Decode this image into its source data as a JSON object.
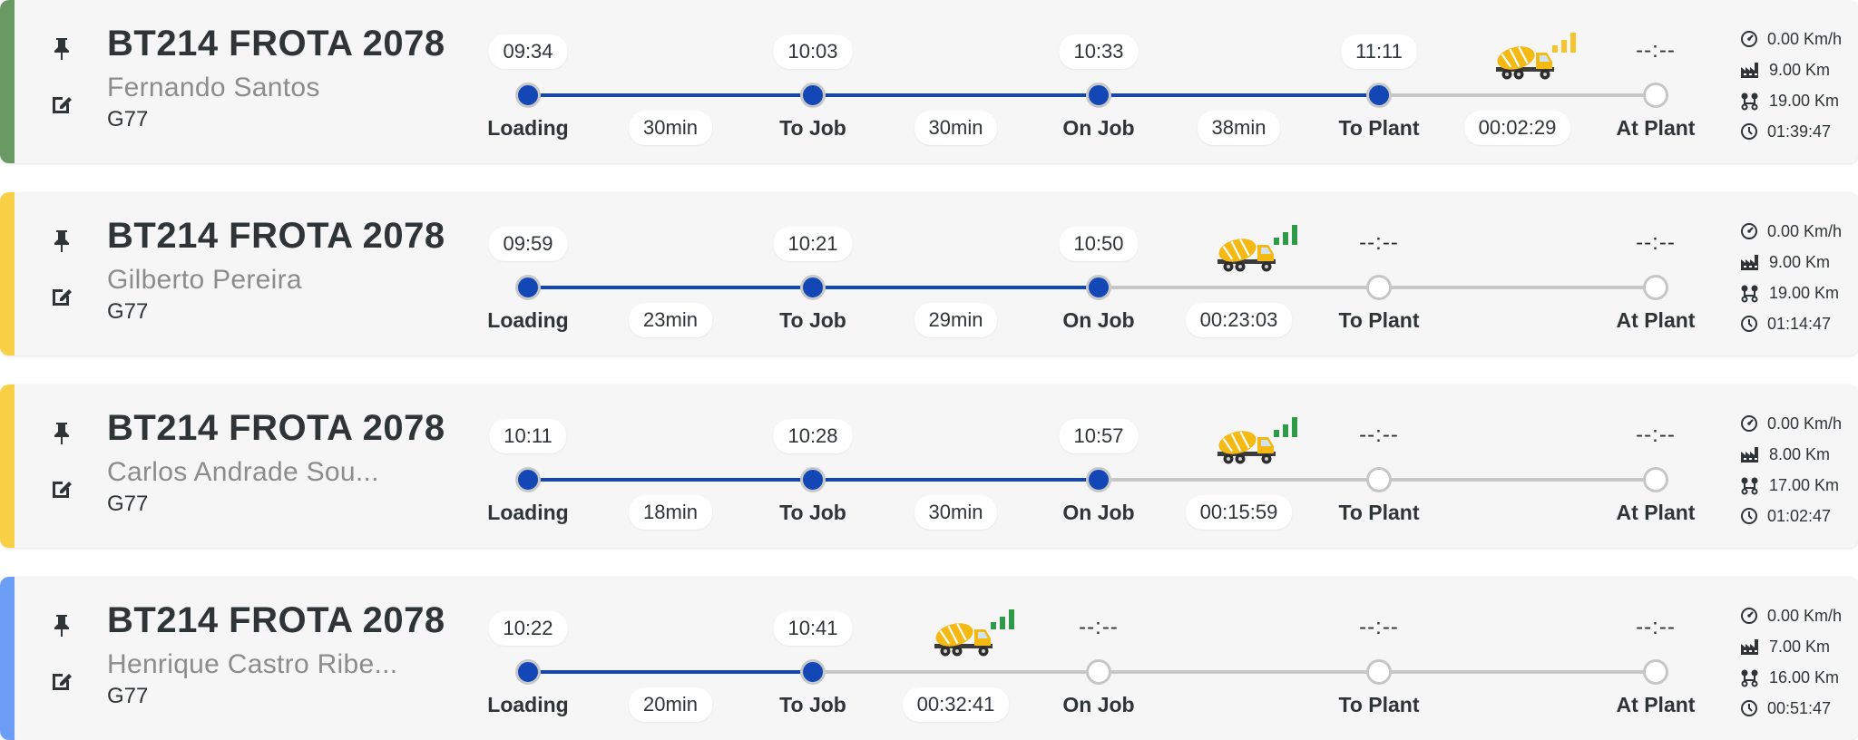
{
  "stripe_colors": [
    "#6a9a64",
    "#f7d046",
    "#f7d046",
    "#6d9ef5"
  ],
  "accent_color": "#1347b5",
  "icons": {
    "pin": "pin-icon",
    "edit": "edit-icon",
    "truck": "concrete-mixer-truck-icon",
    "signal": "signal-strength-icon",
    "speed": "speedometer-icon",
    "plant_distance": "factory-icon",
    "route_distance": "route-icon",
    "elapsed": "clock-icon"
  },
  "stage_labels": [
    "Loading",
    "To Job",
    "On Job",
    "To Plant",
    "At Plant"
  ],
  "trips": [
    {
      "title": "BT214 FROTA 2078",
      "driver": "Fernando Santos",
      "plant": "G77",
      "times": [
        "09:34",
        "10:03",
        "10:33",
        "11:11",
        "--:--"
      ],
      "durations": [
        "30min",
        "30min",
        "38min",
        "00:02:29"
      ],
      "signal_color": "#f4c431",
      "stats": {
        "speed": "0.00 Km/h",
        "plant_distance": "9.00 Km",
        "route_distance": "19.00 Km",
        "elapsed": "01:39:47"
      }
    },
    {
      "title": "BT214 FROTA 2078",
      "driver": "Gilberto Pereira",
      "plant": "G77",
      "times": [
        "09:59",
        "10:21",
        "10:50",
        "--:--",
        "--:--"
      ],
      "durations": [
        "23min",
        "29min",
        "00:23:03"
      ],
      "signal_color": "#2e9a48",
      "stats": {
        "speed": "0.00 Km/h",
        "plant_distance": "9.00 Km",
        "route_distance": "19.00 Km",
        "elapsed": "01:14:47"
      }
    },
    {
      "title": "BT214 FROTA 2078",
      "driver": "Carlos Andrade Sou...",
      "plant": "G77",
      "times": [
        "10:11",
        "10:28",
        "10:57",
        "--:--",
        "--:--"
      ],
      "durations": [
        "18min",
        "30min",
        "00:15:59"
      ],
      "signal_color": "#2e9a48",
      "stats": {
        "speed": "0.00 Km/h",
        "plant_distance": "8.00 Km",
        "route_distance": "17.00 Km",
        "elapsed": "01:02:47"
      }
    },
    {
      "title": "BT214 FROTA 2078",
      "driver": "Henrique Castro Ribe...",
      "plant": "G77",
      "times": [
        "10:22",
        "10:41",
        "--:--",
        "--:--",
        "--:--"
      ],
      "durations": [
        "20min",
        "00:32:41"
      ],
      "signal_color": "#2e9a48",
      "stats": {
        "speed": "0.00 Km/h",
        "plant_distance": "7.00 Km",
        "route_distance": "16.00 Km",
        "elapsed": "00:51:47"
      }
    }
  ]
}
